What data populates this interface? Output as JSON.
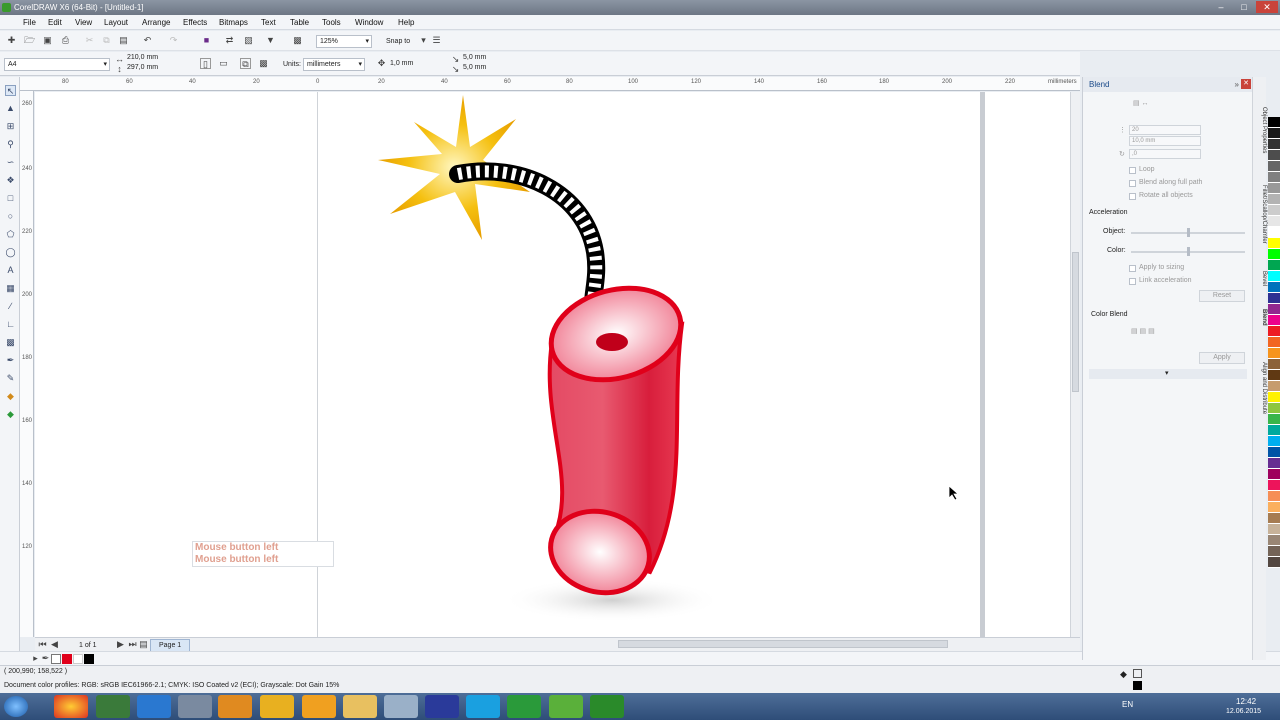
{
  "window": {
    "title": "CorelDRAW X6 (64-Bit) - [Untitled-1]"
  },
  "menu": [
    "File",
    "Edit",
    "View",
    "Layout",
    "Arrange",
    "Effects",
    "Bitmaps",
    "Text",
    "Table",
    "Tools",
    "Window",
    "Help"
  ],
  "toolbar": {
    "zoom": "125%",
    "snap_to": "Snap to"
  },
  "property_bar": {
    "page_size": "A4",
    "width": "210,0 mm",
    "height": "297,0 mm",
    "units_label": "Units:",
    "units": "millimeters",
    "nudge": "1,0 mm",
    "dup_x": "5,0 mm",
    "dup_y": "5,0 mm"
  },
  "ruler": {
    "h_ticks": [
      "80",
      "60",
      "40",
      "20",
      "0",
      "20",
      "40",
      "60",
      "80",
      "100",
      "120",
      "140",
      "160",
      "180",
      "200",
      "220"
    ],
    "unit": "millimeters",
    "v_ticks": [
      "260",
      "240",
      "220",
      "200",
      "180",
      "160",
      "140",
      "120"
    ]
  },
  "overlay": {
    "mouse_line1": "Mouse button left",
    "mouse_line2": "Mouse button left"
  },
  "page_nav": {
    "count": "1 of 1",
    "page_tab": "Page 1"
  },
  "status": {
    "coords": "( 200,990; 158,522 )",
    "profiles": "Document color profiles: RGB: sRGB IEC61966-2.1; CMYK: ISO Coated v2 (ECI); Grayscale: Dot Gain 15%"
  },
  "docker": {
    "title": "Blend",
    "steps": "20",
    "spacing": "10,0 mm",
    "rotation": ",0",
    "loop": "Loop",
    "blend_full_path": "Blend along full path",
    "rotate_all": "Rotate all objects",
    "acceleration": "Acceleration",
    "object": "Object:",
    "color": "Color:",
    "apply_sizing": "Apply to sizing",
    "link_accel": "Link acceleration",
    "reset": "Reset",
    "color_blend": "Color Blend",
    "apply": "Apply"
  },
  "docker_tabs": [
    "Object Properties",
    "Fillet/Scallop/Chamfer",
    "Bevel",
    "Blend",
    "Align and Distribute"
  ],
  "taskbar": {
    "lang": "EN",
    "time": "12:42",
    "date": "12.06.2015"
  },
  "colors": {
    "palette": [
      "#000000",
      "#1a1a1a",
      "#333333",
      "#4d4d4d",
      "#666666",
      "#808080",
      "#999999",
      "#b3b3b3",
      "#cccccc",
      "#e6e6e6",
      "#ffffff",
      "#ffff00",
      "#00ff00",
      "#00a651",
      "#00ffff",
      "#0072bc",
      "#2e3192",
      "#92278f",
      "#ec008c",
      "#ed1c24",
      "#f26522",
      "#f7941d",
      "#8c6239",
      "#603913",
      "#c69c6d",
      "#fff200",
      "#8dc63f",
      "#39b54a",
      "#00a99d",
      "#00aeef",
      "#0054a6",
      "#662d91",
      "#9e005d",
      "#ed145b",
      "#f68e56",
      "#fbaf5d",
      "#a67c52",
      "#c7b299",
      "#998675",
      "#736357",
      "#534741"
    ]
  }
}
